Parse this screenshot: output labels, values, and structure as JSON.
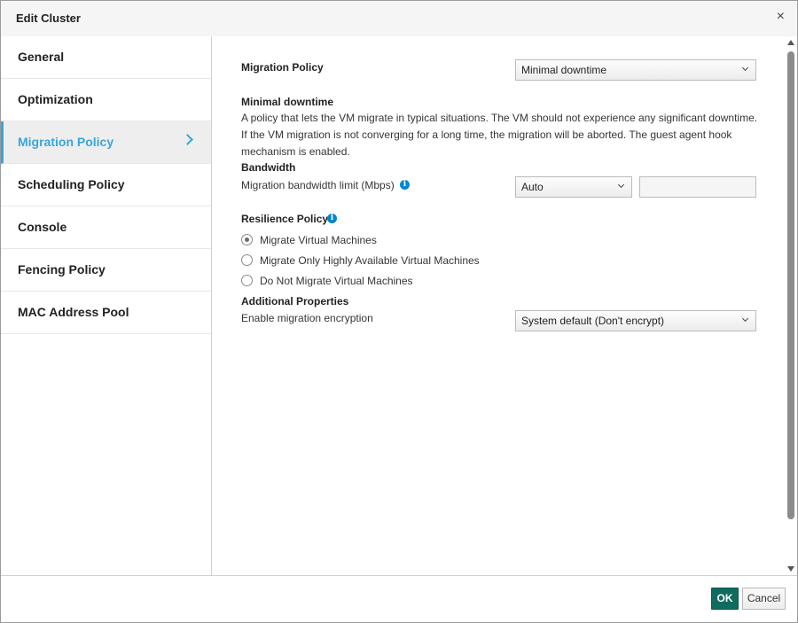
{
  "dialog": {
    "title": "Edit Cluster",
    "close_glyph": "×"
  },
  "sidebar": {
    "items": [
      {
        "label": "General"
      },
      {
        "label": "Optimization"
      },
      {
        "label": "Migration Policy",
        "active": true
      },
      {
        "label": "Scheduling Policy"
      },
      {
        "label": "Console"
      },
      {
        "label": "Fencing Policy"
      },
      {
        "label": "MAC Address Pool"
      }
    ]
  },
  "migration": {
    "policy_label": "Migration Policy",
    "policy_value": "Minimal downtime",
    "policy_heading": "Minimal downtime",
    "policy_description": "A policy that lets the VM migrate in typical situations. The VM should not experience any significant downtime. If the VM migration is not converging for a long time, the migration will be aborted. The guest agent hook mechanism is enabled.",
    "bandwidth_heading": "Bandwidth",
    "bandwidth_label": "Migration bandwidth limit (Mbps)",
    "bandwidth_value": "Auto",
    "bandwidth_custom": "",
    "resilience_heading": "Resilience Policy",
    "resilience_options": [
      {
        "label": "Migrate Virtual Machines",
        "checked": true
      },
      {
        "label": "Migrate Only Highly Available Virtual Machines",
        "checked": false
      },
      {
        "label": "Do Not Migrate Virtual Machines",
        "checked": false
      }
    ],
    "additional_heading": "Additional Properties",
    "encryption_label": "Enable migration encryption",
    "encryption_value": "System default (Don't encrypt)"
  },
  "footer": {
    "ok_label": "OK",
    "cancel_label": "Cancel"
  },
  "colors": {
    "accent": "#39a5dc",
    "ok_button": "#0f6b5e",
    "info_icon": "#0088ce"
  }
}
